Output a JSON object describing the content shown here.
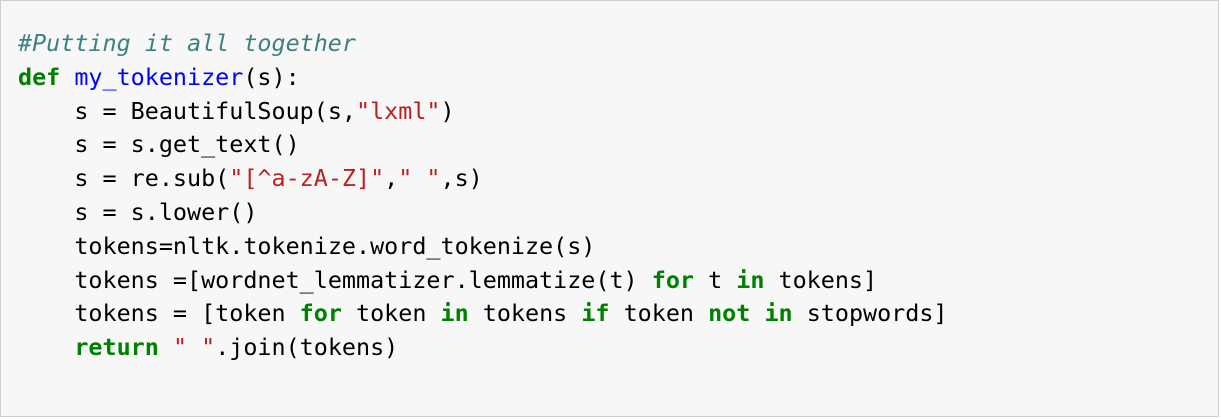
{
  "colors": {
    "cell_background": "#f7f7f7",
    "cell_border": "#cfcfcf",
    "comment": "#408080",
    "keyword": "#008000",
    "function_name": "#0000ff",
    "string": "#ba2121",
    "default": "#000000"
  },
  "code": {
    "line1": {
      "comment": "#Putting it all together"
    },
    "line2": {
      "kw_def": "def",
      "sp": " ",
      "fn_name": "my_tokenizer",
      "rest": "(s):"
    },
    "line3": {
      "indent": "    ",
      "pre": "s = BeautifulSoup(s,",
      "str": "\"lxml\"",
      "post": ")"
    },
    "line4": {
      "indent": "    ",
      "text": "s = s.get_text()"
    },
    "line5": {
      "indent": "    ",
      "pre": "s = re.sub(",
      "str1": "\"[^a-zA-Z]\"",
      "mid": ",",
      "str2": "\" \"",
      "post": ",s)"
    },
    "line6": {
      "indent": "    ",
      "text": "s = s.lower()"
    },
    "line7": {
      "indent": "    ",
      "text": "tokens=nltk.tokenize.word_tokenize(s)"
    },
    "line8": {
      "indent": "    ",
      "pre": "tokens =[wordnet_lemmatizer.lemmatize(t) ",
      "kw_for": "for",
      "mid": " t ",
      "kw_in": "in",
      "post": " tokens]"
    },
    "line9": {
      "indent": "    ",
      "pre": "tokens = [token ",
      "kw_for": "for",
      "mid1": " token ",
      "kw_in1": "in",
      "mid2": " tokens ",
      "kw_if": "if",
      "mid3": " token ",
      "kw_not": "not",
      "sp": " ",
      "kw_in2": "in",
      "post": " stopwords]"
    },
    "line10": {
      "indent": "    ",
      "kw_return": "return",
      "sp": " ",
      "str": "\" \"",
      "post": ".join(tokens)"
    }
  }
}
